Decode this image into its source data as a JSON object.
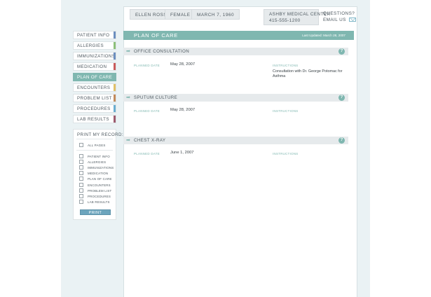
{
  "header": {
    "patient_name": "ELLEN ROSS",
    "gender": "FEMALE",
    "dob": "MARCH 7, 1960",
    "clinic_name": "ASHBY MEDICAL CENTER",
    "clinic_phone": "415-555-1200",
    "questions_label": "QUESTIONS?",
    "email_label": "EMAIL US"
  },
  "nav": {
    "items": [
      {
        "label": "PATIENT INFO",
        "color": "#6c8fbf"
      },
      {
        "label": "ALLERGIES",
        "color": "#8cc07a"
      },
      {
        "label": "IMMUNIZATIONS",
        "color": "#6c8fbf"
      },
      {
        "label": "MEDICATION",
        "color": "#c95b5b"
      },
      {
        "label": "PLAN OF CARE",
        "color": "#7fb7b0",
        "active": true
      },
      {
        "label": "ENCOUNTERS",
        "color": "#e0c067"
      },
      {
        "label": "PROBLEM LIST",
        "color": "#c28a5a"
      },
      {
        "label": "PROCEDURES",
        "color": "#6aaed0"
      },
      {
        "label": "LAB RESULTS",
        "color": "#9c5b6e"
      }
    ]
  },
  "print": {
    "title": "PRINT MY RECORD:",
    "all_pages": "ALL PAGES",
    "options": [
      "PATIENT INFO",
      "ALLERGIES",
      "IMMUNIZATIONS",
      "MEDICATION",
      "PLAN OF CARE",
      "ENCOUNTERS",
      "PROBLEM LIST",
      "PROCEDURES",
      "LAB RESULTS"
    ],
    "button": "PRINT"
  },
  "main": {
    "title": "PLAN OF CARE",
    "last_updated": "Last Updated: March 28, 2007",
    "planned_date_label": "PLANNED DATE",
    "instructions_label": "INSTRUCTIONS",
    "sections": [
      {
        "title": "OFFICE CONSULTATION",
        "date": "May 28, 2007",
        "instructions": "Consultation with Dr. George Potomac for Asthma"
      },
      {
        "title": "SPUTUM CULTURE",
        "date": "May 28, 2007",
        "instructions": ""
      },
      {
        "title": "CHEST X-RAY",
        "date": "June 1, 2007",
        "instructions": ""
      }
    ]
  },
  "colors": {
    "accent": "#7fb7b0",
    "print_button": "#6da5bd",
    "background": "#eaf2f4"
  }
}
